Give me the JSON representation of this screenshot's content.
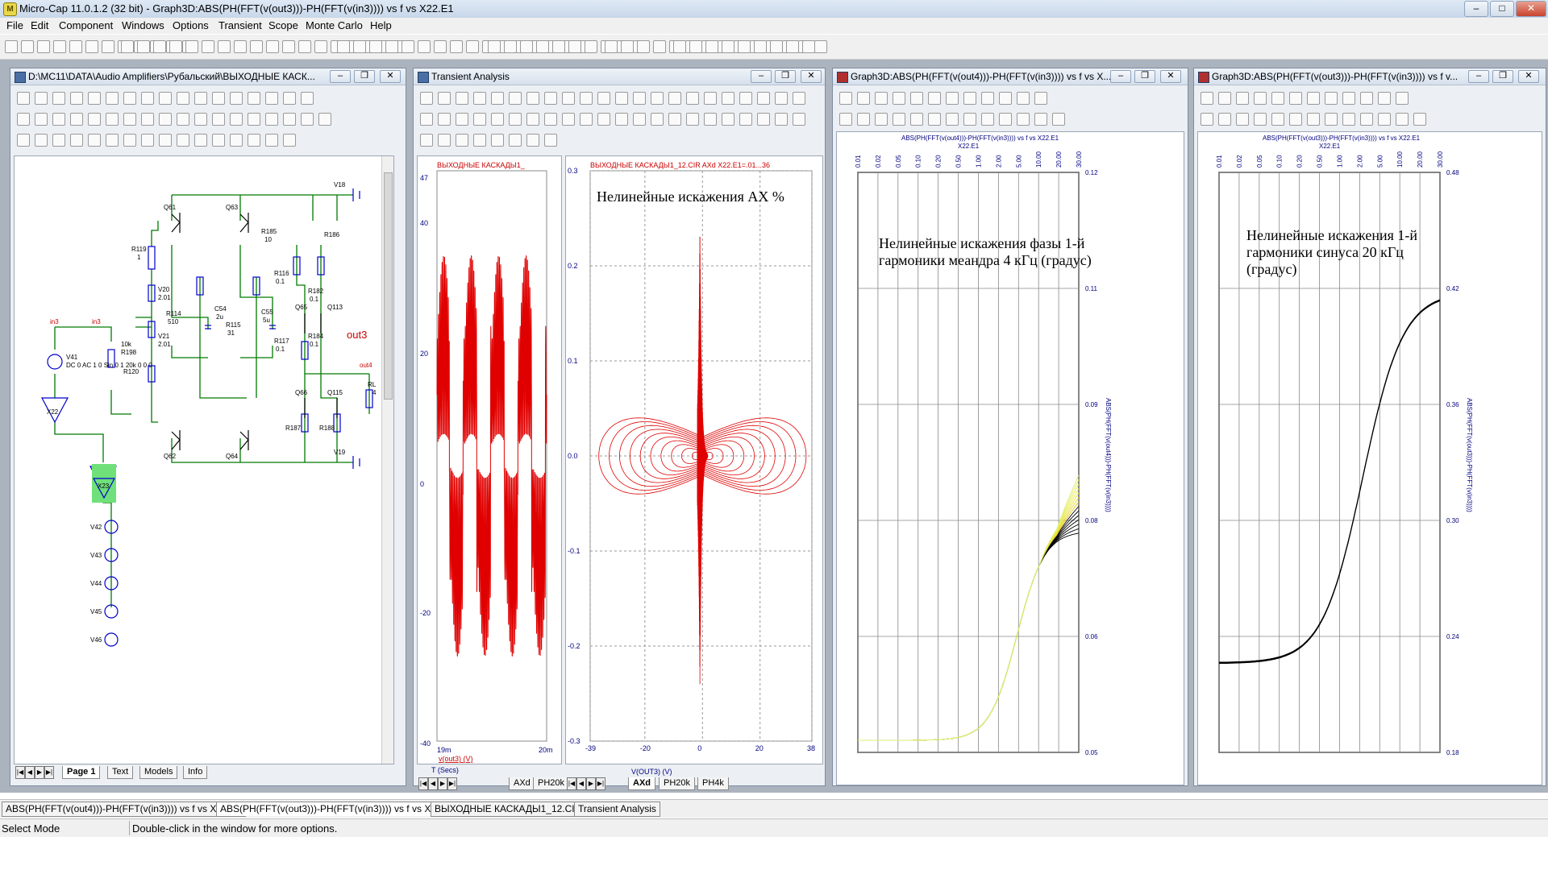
{
  "app": {
    "title": "Micro-Cap 11.0.1.2 (32 bit) - Graph3D:ABS(PH(FFT(v(out3)))-PH(FFT(v(in3)))) vs f vs X22.E1",
    "icon_letter": "M"
  },
  "menu": [
    "File",
    "Edit",
    "Component",
    "Windows",
    "Options",
    "Transient",
    "Scope",
    "Monte Carlo",
    "Help"
  ],
  "schematic": {
    "title": "D:\\MC11\\DATA\\Audio Amplifiers\\Рубальский\\ВЫХОДНЫЕ КАСК...",
    "labels": {
      "v18": "V18",
      "v19": "V19",
      "q61": "Q61",
      "q63": "Q63",
      "q62": "Q62",
      "q64": "Q64",
      "q65": "Q65",
      "q66": "Q66",
      "q113": "Q113",
      "q115": "Q115",
      "r185": "R185",
      "r185v": "10",
      "r186": "R186",
      "r119": "R119",
      "r119v": "1",
      "v20": "V20",
      "v20v": "2.01",
      "v21": "V21",
      "v21v": "2.01",
      "c54": "C54",
      "c54v": "2u",
      "c55": "C55",
      "c55v": "5u",
      "r114": "R114",
      "r114v": "510",
      "r115": "R115",
      "r115v": "31",
      "r116": "R116",
      "r116v": "0.1",
      "r182": "R182",
      "r182v": "0.1",
      "r117": "R117",
      "r117v": "0.1",
      "r184": "R184",
      "r184v": "0.1",
      "r187": "R187",
      "r188": "R188",
      "r198v": "10k",
      "r198": "R198",
      "r120": "R120",
      "in3a": "in3",
      "in3b": "in3",
      "out3": "out3",
      "out4": "out4",
      "rl": "RL",
      "rlv": "4",
      "v41": "V41",
      "v41src": "DC 0 AC 1 0 Sin 0 1 20k 0 0 0",
      "x22": "X22",
      "x23": "X23",
      "v42": "V42",
      "v43": "V43",
      "v44": "V44",
      "v45": "V45",
      "v46": "V46"
    },
    "tabs": [
      "Page 1",
      "Text",
      "Models",
      "Info"
    ]
  },
  "transient": {
    "title": "Transient Analysis",
    "left_plot": {
      "title": "ВЫХОДНЫЕ КАСКАДЫ1_",
      "y_ticks": [
        "47",
        "40",
        "20",
        "0",
        "-20",
        "-40"
      ],
      "x_ticks": [
        "19m",
        "20m"
      ],
      "trace_label": "v(out3) (V)",
      "x_label": "T (Secs)"
    },
    "right_plot": {
      "title": "ВЫХОДНЫЕ КАСКАДЫ1_12.CIR AXd X22.E1=.01...36",
      "caption": "Нелинейные искажения АХ %",
      "y_ticks": [
        "0.3",
        "0.2",
        "0.1",
        "0.0",
        "-0.1",
        "-0.2",
        "-0.3"
      ],
      "x_ticks": [
        "-39",
        "-20",
        "0",
        "20",
        "38"
      ],
      "x_label": "V(OUT3) (V)"
    },
    "tabs_left": [
      "AXd",
      "PH20k"
    ],
    "tabs_right": [
      "AXd",
      "PH20k",
      "PH4k"
    ]
  },
  "graph1": {
    "title": "Graph3D:ABS(PH(FFT(v(out4)))-PH(FFT(v(in3)))) vs f vs X...",
    "top_label": "ABS(PH(FFT(v(out4)))-PH(FFT(v(in3))))  vs f vs X22.E1",
    "top_label2": "X22.E1",
    "caption": "Нелинейные искажения фазы 1-й гармоники меандра 4 кГц (градус)",
    "top_ticks": [
      "0.01",
      "0.02",
      "0.05",
      "0.10",
      "0.20",
      "0.50",
      "1.00",
      "2.00",
      "5.00",
      "10.00",
      "20.00",
      "30.00"
    ],
    "right_ticks": [
      "0.12",
      "0.11",
      "0.09",
      "0.08",
      "0.06",
      "0.05"
    ],
    "right_label": "ABS(PH(FFT(v(out4)))-PH(FFT(v(in3))))"
  },
  "graph2": {
    "title": "Graph3D:ABS(PH(FFT(v(out3)))-PH(FFT(v(in3)))) vs f v...",
    "top_label": "ABS(PH(FFT(v(out3)))-PH(FFT(v(in3))))  vs f vs X22.E1",
    "top_label2": "X22.E1",
    "caption": "Нелинейные искажения 1-й гармоники синуса 20 кГц (градус)",
    "top_ticks": [
      "0.01",
      "0.02",
      "0.05",
      "0.10",
      "0.20",
      "0.50",
      "1.00",
      "2.00",
      "5.00",
      "10.00",
      "20.00",
      "30.00"
    ],
    "right_ticks": [
      "0.48",
      "0.42",
      "0.36",
      "0.30",
      "0.24",
      "0.18"
    ],
    "right_label": "ABS(PH(FFT(v(out3)))-PH(FFT(v(in3))))"
  },
  "bottom_tabs": [
    "ABS(PH(FFT(v(out4)))-PH(FFT(v(in3)))) vs f vs X22.E1",
    "ABS(PH(FFT(v(out3)))-PH(FFT(v(in3)))) vs f vs X22.E1",
    "ВЫХОДНЫЕ КАСКАДЫ1_12.CIR",
    "Transient Analysis"
  ],
  "status": {
    "mode": "Select Mode",
    "hint": "Double-click in the window for more options."
  },
  "colors": {
    "wire": "#007a00",
    "component": "#0000cc",
    "trace": "#e00000",
    "axis_text": "#000080",
    "highlight": "#6fe07a"
  }
}
